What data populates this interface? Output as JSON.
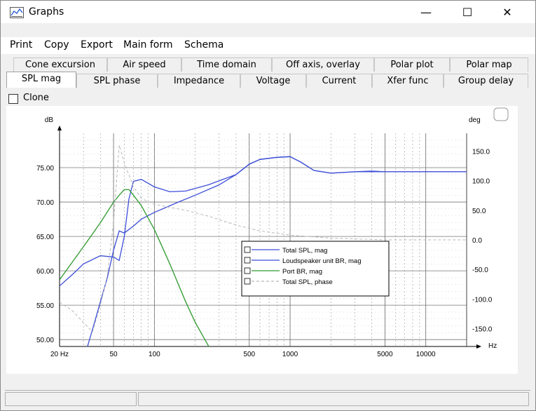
{
  "window": {
    "title": "Graphs",
    "minimize": "—",
    "maximize": "☐",
    "close": "✕"
  },
  "menu": [
    "Print",
    "Copy",
    "Export",
    "Main form",
    "Schema"
  ],
  "tabs_row1": [
    "Cone excursion",
    "Air speed",
    "Time domain",
    "Off axis, overlay",
    "Polar plot",
    "Polar map"
  ],
  "tabs_row2": [
    "SPL mag",
    "SPL phase",
    "Impedance",
    "Voltage",
    "Current",
    "Xfer func",
    "Group delay"
  ],
  "active_tab": "SPL mag",
  "clone": {
    "label": "Clone",
    "checked": false
  },
  "chart_data": {
    "type": "line",
    "x_scale": "log",
    "xlim": [
      20,
      20000
    ],
    "ylim": [
      49,
      80
    ],
    "y2lim": [
      -180,
      180
    ],
    "ylabel": "dB",
    "y2label": "deg",
    "xunit": "Hz",
    "x_ticks": [
      "20 Hz",
      "50",
      "100",
      "500",
      "1000",
      "5000",
      "10000"
    ],
    "x_tick_values": [
      20,
      50,
      100,
      500,
      1000,
      5000,
      10000
    ],
    "y_ticks": [
      "75.00",
      "70.00",
      "65.00",
      "60.00",
      "55.00",
      "50.00"
    ],
    "y_tick_values": [
      75,
      70,
      65,
      60,
      55,
      50
    ],
    "y2_ticks": [
      "150.0",
      "100.0",
      "50.0",
      "0.0",
      "-50.0",
      "-100.0",
      "-150.0"
    ],
    "y2_tick_values": [
      150,
      100,
      50,
      0,
      -50,
      -100,
      -150
    ],
    "grid": true,
    "legend_position": "center-right",
    "series": [
      {
        "name": "Total SPL, mag",
        "color": "#3c4ed8",
        "dash": "",
        "axis": "left",
        "x": [
          20,
          25,
          30,
          40,
          50,
          55,
          60,
          65,
          70,
          80,
          100,
          130,
          170,
          250,
          400,
          500,
          600,
          800,
          1000,
          1200,
          1500,
          2000,
          3000,
          4000,
          5000,
          10000,
          20000
        ],
        "y": [
          57.8,
          59.5,
          61.0,
          62.2,
          62.0,
          61.5,
          65.0,
          70.5,
          73.0,
          73.3,
          72.2,
          71.5,
          71.6,
          72.5,
          74.0,
          75.5,
          76.2,
          76.5,
          76.6,
          75.8,
          74.6,
          74.2,
          74.4,
          74.5,
          74.4,
          74.4,
          74.4
        ]
      },
      {
        "name": "Loudspeaker unit BR, mag",
        "color": "#3c4ed8",
        "dash": "",
        "axis": "left",
        "x": [
          30,
          35,
          40,
          45,
          50,
          55,
          60,
          70,
          80,
          100,
          150,
          200,
          300,
          400,
          500,
          600,
          800,
          1000,
          1200,
          1500,
          2000,
          3000,
          5000,
          10000,
          20000
        ],
        "y": [
          47,
          51.5,
          55.5,
          59,
          63,
          65.8,
          65.5,
          66.5,
          67.5,
          68.5,
          70.0,
          71.0,
          72.5,
          74.0,
          75.5,
          76.2,
          76.5,
          76.6,
          75.8,
          74.6,
          74.2,
          74.4,
          74.4,
          74.4,
          74.4
        ]
      },
      {
        "name": "Port BR, mag",
        "color": "#2e9a2e",
        "dash": "",
        "axis": "left",
        "x": [
          20,
          30,
          40,
          50,
          55,
          60,
          65,
          70,
          80,
          100,
          130,
          170,
          200,
          260
        ],
        "y": [
          58.7,
          63.5,
          67.0,
          70.0,
          71.0,
          71.8,
          71.8,
          71.0,
          69.5,
          66.0,
          61.0,
          55.5,
          52.5,
          48.5
        ]
      },
      {
        "name": "Total SPL, phase",
        "color": "#b8b8b8",
        "dash": "4,3",
        "axis": "right",
        "x": [
          20,
          25,
          30,
          35,
          40,
          45,
          50,
          55,
          60,
          70,
          80,
          100,
          130,
          170,
          250,
          400,
          600,
          1000,
          2000,
          5000,
          10000,
          20000
        ],
        "y": [
          -105,
          -120,
          -140,
          -155,
          -110,
          -60,
          30,
          160,
          130,
          90,
          70,
          60,
          55,
          50,
          40,
          25,
          15,
          8,
          3,
          0,
          0,
          0
        ]
      }
    ]
  }
}
